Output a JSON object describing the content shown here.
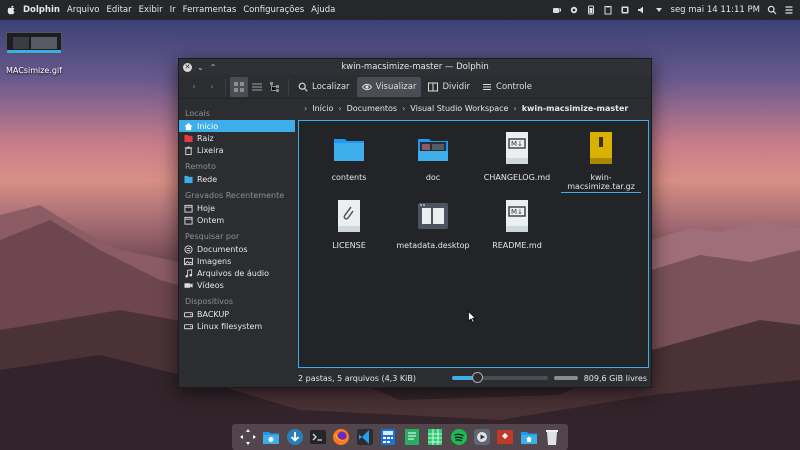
{
  "menubar": {
    "app_name": "Dolphin",
    "items": [
      "Arquivo",
      "Editar",
      "Exibir",
      "Ir",
      "Ferramentas",
      "Configurações",
      "Ajuda"
    ],
    "clock": "seg mai 14 11:11 PM"
  },
  "desktop": {
    "icon_label": "MACsimize.gif"
  },
  "window": {
    "title": "kwin-macsimize-master — Dolphin",
    "toolbar": {
      "find": "Localizar",
      "view": "Visualizar",
      "split": "Dividir",
      "control": "Controle"
    },
    "sidebar": {
      "sections": [
        {
          "header": "Locais",
          "items": [
            "Início",
            "Raiz",
            "Lixeira"
          ]
        },
        {
          "header": "Remoto",
          "items": [
            "Rede"
          ]
        },
        {
          "header": "Gravados Recentemente",
          "items": [
            "Hoje",
            "Ontem"
          ]
        },
        {
          "header": "Pesquisar por",
          "items": [
            "Documentos",
            "Imagens",
            "Arquivos de áudio",
            "Vídeos"
          ]
        },
        {
          "header": "Dispositivos",
          "items": [
            "BACKUP",
            "Linux filesystem"
          ]
        }
      ]
    },
    "breadcrumb": [
      "Início",
      "Documentos",
      "Visual Studio Workspace",
      "kwin-macsimize-master"
    ],
    "files": [
      {
        "name": "contents",
        "type": "folder"
      },
      {
        "name": "doc",
        "type": "folder-image"
      },
      {
        "name": "CHANGELOG.md",
        "type": "md",
        "badge": "md"
      },
      {
        "name": "kwin-macsimize.tar.gz",
        "type": "tar",
        "badge": "tar"
      },
      {
        "name": "LICENSE",
        "type": "text",
        "badge": "text"
      },
      {
        "name": "metadata.desktop",
        "type": "desktop"
      },
      {
        "name": "README.md",
        "type": "md",
        "badge": "md"
      }
    ],
    "status": {
      "summary": "2 pastas, 5 arquivos (4,3 KiB)",
      "free_space": "809,6 GiB livres",
      "zoom_fraction": 0.27
    }
  },
  "colors": {
    "accent": "#3daee9",
    "window_bg": "#2b2d31",
    "content_bg": "#232427"
  }
}
